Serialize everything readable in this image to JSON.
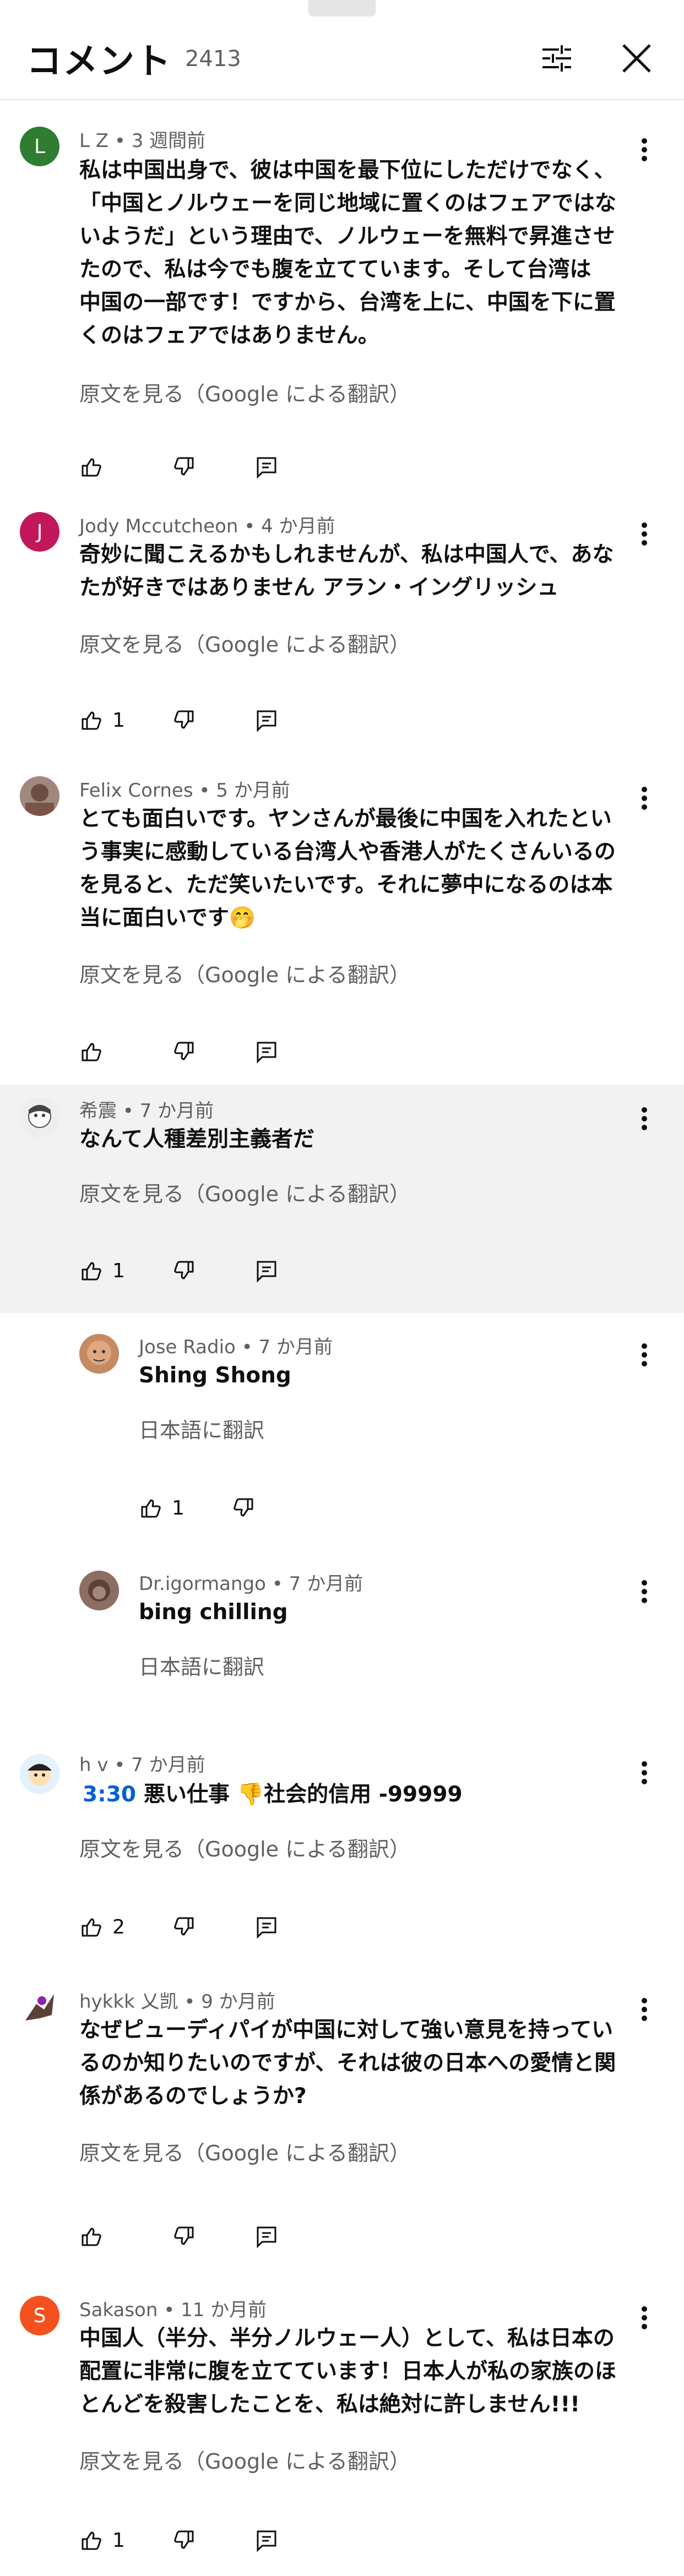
{
  "header": {
    "title": "コメント",
    "count": "2413",
    "filter_icon": "tune-icon",
    "close_icon": "close-icon"
  },
  "comments": [
    {
      "author": "L Z",
      "time": "3 週間前",
      "avatar_letter": "L",
      "avatar_color": "#2e7d32",
      "lines": [
        "私は中国出身で、彼は中国を最下位にしただけでなく、",
        "「中国とノルウェーを同じ地域に置くのはフェアではな",
        "いようだ」という理由で、ノルウェーを無料で昇進させ",
        "たので、私は今でも腹を立てています。そして台湾は",
        "中国の一部です！ですから、台湾を上に、中国を下に置",
        "くのはフェアではありません。"
      ],
      "translate": "原文を見る（Google による翻訳）",
      "likes": ""
    },
    {
      "author": "Jody Mccutcheon",
      "time": "4 か月前",
      "avatar_letter": "J",
      "avatar_color": "#c2185b",
      "lines": [
        "奇妙に聞こえるかもしれませんが、私は中国人で、あな",
        "たが好きではありません アラン・イングリッシュ"
      ],
      "translate": "原文を見る（Google による翻訳）",
      "likes": "1"
    },
    {
      "author": "Felix Cornes",
      "time": "5 か月前",
      "avatar_letter": "",
      "avatar_color": "#8d6e63",
      "lines": [
        "とても面白いです。ヤンさんが最後に中国を入れたとい",
        "う事実に感動している台湾人や香港人がたくさんいるの",
        "を見ると、ただ笑いたいです。それに夢中になるのは本",
        "当に面白いです🤭"
      ],
      "translate": "原文を見る（Google による翻訳）",
      "likes": ""
    },
    {
      "author": "希震",
      "time": "7 か月前",
      "avatar_letter": "",
      "avatar_color": "#bdbdbd",
      "lines": [
        "なんて人種差別主義者だ"
      ],
      "translate": "原文を見る（Google による翻訳）",
      "likes": "1"
    }
  ],
  "replies": [
    {
      "author": "Jose Radio",
      "time": "7 か月前",
      "avatar_color": "#a1674a",
      "text": "Shing Shong",
      "translate": "日本語に翻訳",
      "likes": "1"
    },
    {
      "author": "Dr.igormango",
      "time": "7 か月前",
      "avatar_color": "#6d4c41",
      "text": "bing chilling",
      "translate": "日本語に翻訳",
      "likes": ""
    }
  ],
  "more_comments": [
    {
      "author": "h v",
      "time": "7 か月前",
      "avatar_color": "#90caf9",
      "timestamp_link": "3:30",
      "text": "悪い仕事 👎社会的信用 -99999",
      "translate": "原文を見る（Google による翻訳）",
      "likes": "2"
    },
    {
      "author": "hykkk 乂凯",
      "time": "9 か月前",
      "avatar_color": "#5d4037",
      "lines": [
        "なぜピューディパイが中国に対して強い意見を持ってい",
        "るのか知りたいのですが、それは彼の日本への愛情と関",
        "係があるのでしょうか?"
      ],
      "translate": "原文を見る（Google による翻訳）",
      "likes": ""
    },
    {
      "author": "Sakason",
      "time": "11 か月前",
      "avatar_letter": "S",
      "avatar_color": "#f4511e",
      "lines": [
        "中国人（半分、半分ノルウェー人）として、私は日本の",
        "配置に非常に腹を立てています！日本人が私の家族のほ",
        "とんどを殺害したことを、私は絶対に許しません!!!"
      ],
      "translate": "原文を見る（Google による翻訳）",
      "likes": "1"
    }
  ]
}
